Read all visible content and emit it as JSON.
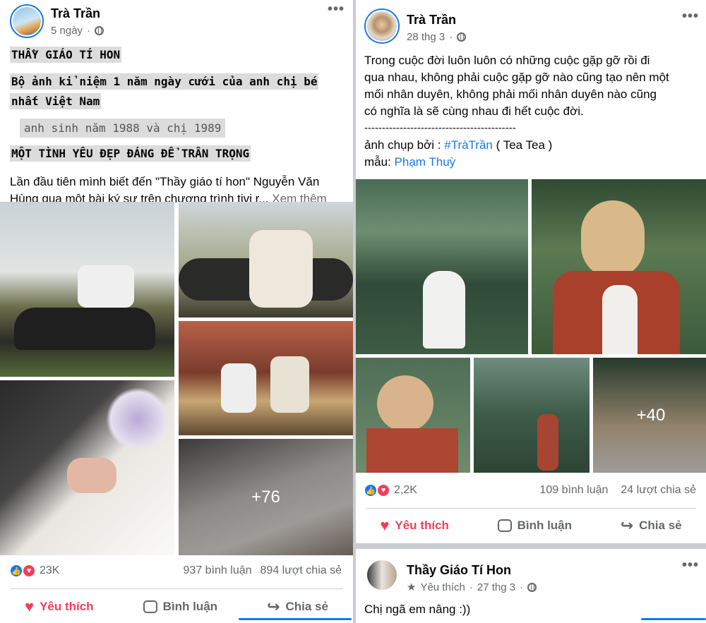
{
  "left_post": {
    "author": "Trà Trần",
    "time": "5 ngày",
    "line1": "THẦY GIÁO TÍ HON",
    "line2a": "Bộ ảnh kỉ niệm 1 năm ngày cưới của anh chị bé",
    "line2b": "nhất Việt Nam",
    "line3": "anh sinh năm 1988 và chị 1989",
    "line4": "MỘT TÌNH YÊU ĐẸP ĐÁNG ĐỂ TRÂN TRỌNG",
    "body_a": "Lần đầu tiên mình biết đến \"Thầy giáo tí hon\" Nguyễn Văn",
    "body_b": "Hùng qua một bài ký sự trên chương trình tivi r...",
    "see_more": "Xem thêm",
    "more_photos": "+76",
    "reactions": "23K",
    "comments": "937 bình luận",
    "shares": "894 lượt chia sẻ",
    "like_label": "Yêu thích",
    "comment_label": "Bình luận",
    "share_label": "Chia sẻ"
  },
  "right_post": {
    "author": "Trà Trần",
    "time": "28 thg 3",
    "text1": "Trong cuộc đời luôn luôn có những cuộc gặp gỡ rồi đi",
    "text2": "qua nhau, không phải cuộc gặp gỡ nào cũng tạo nên một",
    "text3": "mối nhân duyên, không phải mối nhân duyên nào cũng",
    "text4": "có nghĩa là sẽ cùng nhau đi hết cuộc đời.",
    "separator": "-------------------------------------------",
    "credit_prefix": "ảnh chụp bởi :",
    "credit_tag": "#TràTrần",
    "credit_suffix": "( Tea Tea )",
    "model_prefix": "mẫu:",
    "model_name": "Phạm Thuỳ",
    "more_photos": "+40",
    "reactions": "2,2K",
    "comments": "109 bình luận",
    "shares": "24 lượt chia sẻ",
    "like_label": "Yêu thích",
    "comment_label": "Bình luận",
    "share_label": "Chia sẻ"
  },
  "comment_post": {
    "author": "Thầy Giáo Tí Hon",
    "reaction": "Yêu thích",
    "time": "27 thg 3",
    "text": "Chị ngã em nâng :))"
  },
  "colors": {
    "accent": "#1877f2",
    "love": "#f33e58",
    "muted": "#65676b"
  }
}
